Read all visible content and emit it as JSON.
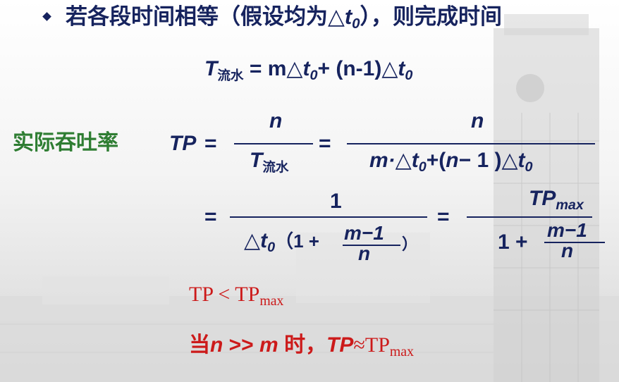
{
  "colors": {
    "navy": "#16235e",
    "green": "#2e7d32",
    "red": "#cc1a1a"
  },
  "bullet": {
    "icon": "diamond-bullet-icon",
    "text_before": "若各段时间相等（假设均为△",
    "var_t": "t",
    "var_sub": "0",
    "text_after": "），则完成时间"
  },
  "eq1": {
    "T": "T",
    "T_sub": "流水",
    "rhs1": " = m△",
    "t": "t",
    "t_sub": "0",
    "rhs2": "+ (n-1)△",
    "t2": "t",
    "t2_sub": "0"
  },
  "label": "实际吞吐率",
  "eq2": {
    "lhs": "TP",
    "eq": "=",
    "f1_num": "n",
    "f1_den_T": "T",
    "f1_den_sub": "流水",
    "eq_b": "=",
    "f2_num": "n",
    "f2_den_a": "m·△",
    "f2_den_t": "t",
    "f2_den_t_sub": "0",
    "f2_den_b": "+(",
    "f2_den_n": "n",
    "f2_den_c": "− 1 )△",
    "f2_den_t2": "t",
    "f2_den_t2_sub": "0"
  },
  "eq3": {
    "eq": "=",
    "f3_num": "1",
    "f3_den_delta": "△",
    "f3_den_t": "t",
    "f3_den_t_sub": "0",
    "f3_den_open": "（1 +",
    "f3_den_inner_num": "m−1",
    "f3_den_inner_den": "n",
    "f3_den_close": "）",
    "eq_b": "=",
    "f4_num": "TP",
    "f4_num_sub": "max",
    "f4_den_a": "1 +",
    "f4_den_inner_num": "m−1",
    "f4_den_inner_den": "n"
  },
  "ineq": {
    "lhs": "TP",
    "op": " < ",
    "rhs": "TP",
    "rhs_sub": "max"
  },
  "conclusion": {
    "a": "当",
    "n": "n",
    "op": " >> ",
    "m": "m",
    "b": " 时，",
    "tp": "TP",
    "approx": "≈TP",
    "sub": "max"
  }
}
